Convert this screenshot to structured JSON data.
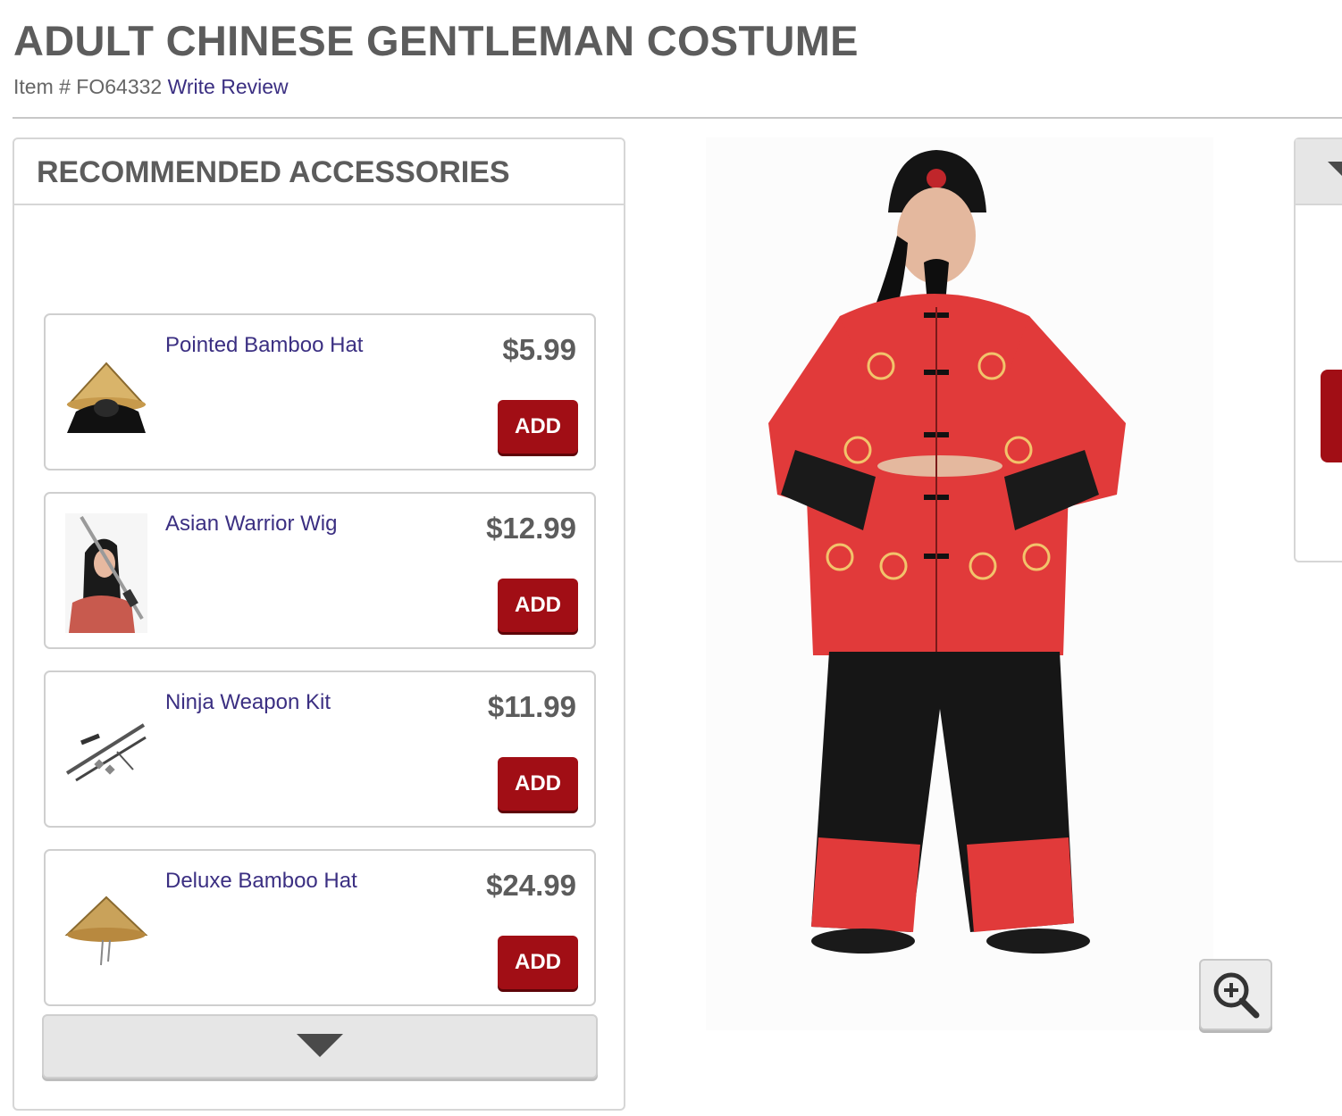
{
  "product": {
    "title": "ADULT CHINESE GENTLEMAN COSTUME",
    "item_label": "Item # FO64332",
    "write_review": "Write Review",
    "image_icon": "costume-photo"
  },
  "accessories": {
    "heading": "RECOMMENDED ACCESSORIES",
    "add_label": "ADD",
    "items": [
      {
        "name": "Pointed Bamboo Hat",
        "price": "$5.99",
        "icon": "bamboo-hat-thumbnail"
      },
      {
        "name": "Asian Warrior Wig",
        "price": "$12.99",
        "icon": "warrior-wig-thumbnail"
      },
      {
        "name": "Ninja Weapon Kit",
        "price": "$11.99",
        "icon": "weapon-kit-thumbnail"
      },
      {
        "name": "Deluxe Bamboo Hat",
        "price": "$24.99",
        "icon": "deluxe-hat-thumbnail"
      }
    ],
    "scroll_icon": "chevron-down-icon"
  },
  "controls": {
    "zoom_icon": "zoom-in-icon"
  },
  "colors": {
    "brand_red": "#a10e15",
    "link_purple": "#3b2f82",
    "heading_gray": "#5c5c5c"
  }
}
